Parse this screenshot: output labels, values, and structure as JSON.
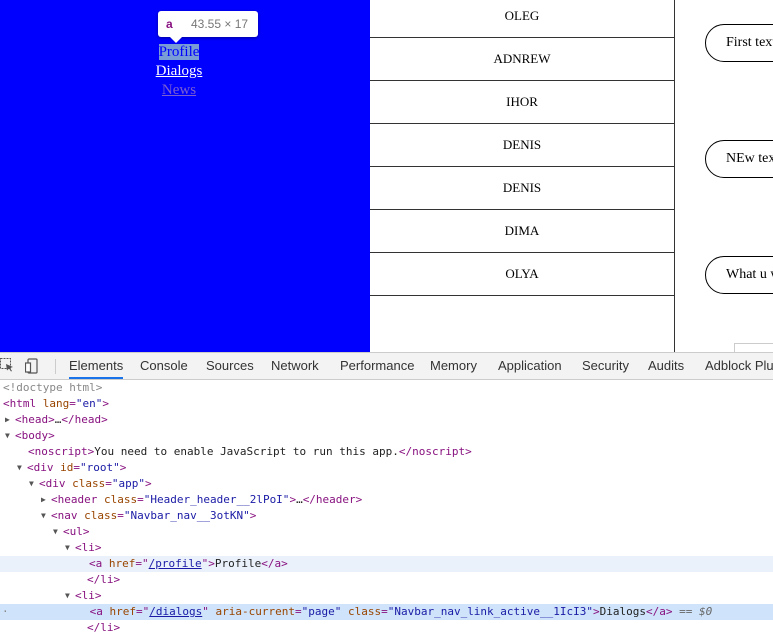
{
  "tooltip": {
    "tag": "a",
    "size": "43.55 × 17"
  },
  "navbar": {
    "items": [
      {
        "label": "Profile"
      },
      {
        "label": "Dialogs"
      },
      {
        "label": "News"
      }
    ]
  },
  "dialogs": [
    "OLEG",
    "ADNREW",
    "IHOR",
    "DENIS",
    "DENIS",
    "DIMA",
    "OLYA"
  ],
  "messages": [
    "First text",
    "NEw text",
    "What u w"
  ],
  "devtools": {
    "tabs": [
      "Elements",
      "Console",
      "Sources",
      "Network",
      "Performance",
      "Memory",
      "Application",
      "Security",
      "Audits",
      "Adblock Plus"
    ],
    "tree": {
      "doctype": "<!doctype html>",
      "html_tag": "html",
      "html_attr": "lang",
      "html_val": "\"en\"",
      "head": "head",
      "body": "body",
      "noscript_text": "You need to enable JavaScript to run this app.",
      "root_attr": "id",
      "root_val": "\"root\"",
      "app_attr": "class",
      "app_val": "\"app\"",
      "header_val": "\"Header_header__2lPoI\"",
      "nav_val": "\"Navbar_nav__3otKN\"",
      "profile_href": "/profile",
      "profile_text": "Profile",
      "dialogs_href": "/dialogs",
      "aria_val": "\"page\"",
      "active_class": "\"Navbar_nav_link_active__1IcI3\"",
      "dialogs_text": "Dialogs",
      "eq": "== $0"
    }
  }
}
